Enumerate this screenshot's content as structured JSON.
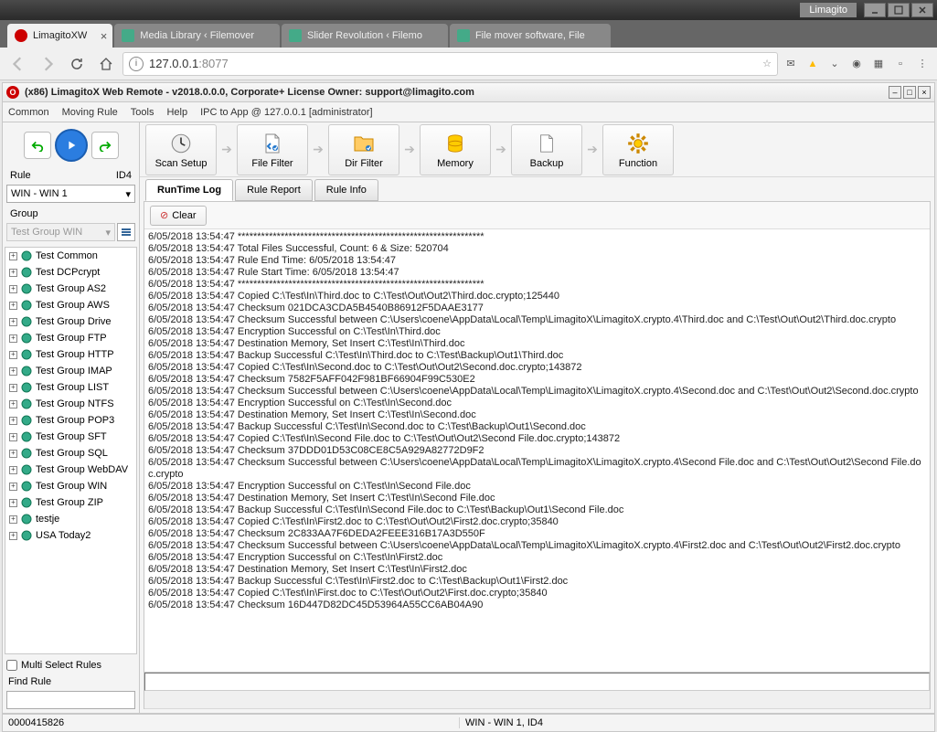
{
  "window": {
    "app_label": "Limagito"
  },
  "browser_tabs": [
    {
      "label": "LimagitoXW",
      "active": true
    },
    {
      "label": "Media Library ‹ Filemover",
      "active": false
    },
    {
      "label": "Slider Revolution ‹ Filemo",
      "active": false
    },
    {
      "label": "File mover software, File",
      "active": false
    }
  ],
  "url": {
    "host": "127.0.0.1",
    "port": ":8077"
  },
  "app_title": "(x86) LimagitoX Web Remote - v2018.0.0.0, Corporate+ License Owner: support@limagito.com",
  "menu": {
    "common": "Common",
    "moving_rule": "Moving Rule",
    "tools": "Tools",
    "help": "Help",
    "ipc": "IPC to App @ 127.0.0.1 [administrator]"
  },
  "left": {
    "rule_label": "Rule",
    "id_label": "ID4",
    "rule_value": "WIN - WIN 1",
    "group_label": "Group",
    "group_value": "Test Group WIN",
    "multi_select": "Multi Select Rules",
    "find_label": "Find Rule",
    "tree": [
      "Test Common",
      "Test DCPcrypt",
      "Test Group AS2",
      "Test Group AWS",
      "Test Group Drive",
      "Test Group FTP",
      "Test Group HTTP",
      "Test Group IMAP",
      "Test Group LIST",
      "Test Group NTFS",
      "Test Group POP3",
      "Test Group SFT",
      "Test Group SQL",
      "Test Group WebDAV",
      "Test Group WIN",
      "Test Group ZIP",
      "testje",
      "USA Today2"
    ]
  },
  "toolbar": {
    "scan_setup": "Scan Setup",
    "file_filter": "File Filter",
    "dir_filter": "Dir Filter",
    "memory": "Memory",
    "backup": "Backup",
    "function": "Function"
  },
  "tabs": {
    "runtime": "RunTime Log",
    "report": "Rule Report",
    "info": "Rule Info"
  },
  "clear_btn": "Clear",
  "log_lines": [
    "6/05/2018 13:54:47 ***************************************************************",
    "6/05/2018 13:54:47 Total Files Successful, Count: 6 & Size: 520704",
    "6/05/2018 13:54:47 Rule End Time: 6/05/2018 13:54:47",
    "6/05/2018 13:54:47 Rule Start Time: 6/05/2018 13:54:47",
    "6/05/2018 13:54:47 ***************************************************************",
    "6/05/2018 13:54:47 Copied C:\\Test\\In\\Third.doc to C:\\Test\\Out\\Out2\\Third.doc.crypto;125440",
    "6/05/2018 13:54:47 Checksum 021DCA3CDA5B4540B86912F5DAAE3177",
    "6/05/2018 13:54:47 Checksum Successful between C:\\Users\\coene\\AppData\\Local\\Temp\\LimagitoX\\LimagitoX.crypto.4\\Third.doc and C:\\Test\\Out\\Out2\\Third.doc.crypto",
    "6/05/2018 13:54:47 Encryption Successful on C:\\Test\\In\\Third.doc",
    "6/05/2018 13:54:47 Destination Memory, Set Insert C:\\Test\\In\\Third.doc",
    "6/05/2018 13:54:47 Backup Successful C:\\Test\\In\\Third.doc to C:\\Test\\Backup\\Out1\\Third.doc",
    "6/05/2018 13:54:47 Copied C:\\Test\\In\\Second.doc to C:\\Test\\Out\\Out2\\Second.doc.crypto;143872",
    "6/05/2018 13:54:47 Checksum 7582F5AFF042F981BF66904F99C530E2",
    "6/05/2018 13:54:47 Checksum Successful between C:\\Users\\coene\\AppData\\Local\\Temp\\LimagitoX\\LimagitoX.crypto.4\\Second.doc and C:\\Test\\Out\\Out2\\Second.doc.crypto",
    "6/05/2018 13:54:47 Encryption Successful on C:\\Test\\In\\Second.doc",
    "6/05/2018 13:54:47 Destination Memory, Set Insert C:\\Test\\In\\Second.doc",
    "6/05/2018 13:54:47 Backup Successful C:\\Test\\In\\Second.doc to C:\\Test\\Backup\\Out1\\Second.doc",
    "6/05/2018 13:54:47 Copied C:\\Test\\In\\Second File.doc to C:\\Test\\Out\\Out2\\Second File.doc.crypto;143872",
    "6/05/2018 13:54:47 Checksum 37DDD01D53C08CE8C5A929A82772D9F2",
    "6/05/2018 13:54:47 Checksum Successful between C:\\Users\\coene\\AppData\\Local\\Temp\\LimagitoX\\LimagitoX.crypto.4\\Second File.doc and C:\\Test\\Out\\Out2\\Second File.doc.crypto",
    "6/05/2018 13:54:47 Encryption Successful on C:\\Test\\In\\Second File.doc",
    "6/05/2018 13:54:47 Destination Memory, Set Insert C:\\Test\\In\\Second File.doc",
    "6/05/2018 13:54:47 Backup Successful C:\\Test\\In\\Second File.doc to C:\\Test\\Backup\\Out1\\Second File.doc",
    "6/05/2018 13:54:47 Copied C:\\Test\\In\\First2.doc to C:\\Test\\Out\\Out2\\First2.doc.crypto;35840",
    "6/05/2018 13:54:47 Checksum 2C833AA7F6DEDA2FEEE316B17A3D550F",
    "6/05/2018 13:54:47 Checksum Successful between C:\\Users\\coene\\AppData\\Local\\Temp\\LimagitoX\\LimagitoX.crypto.4\\First2.doc and C:\\Test\\Out\\Out2\\First2.doc.crypto",
    "6/05/2018 13:54:47 Encryption Successful on C:\\Test\\In\\First2.doc",
    "6/05/2018 13:54:47 Destination Memory, Set Insert C:\\Test\\In\\First2.doc",
    "6/05/2018 13:54:47 Backup Successful C:\\Test\\In\\First2.doc to C:\\Test\\Backup\\Out1\\First2.doc",
    "6/05/2018 13:54:47 Copied C:\\Test\\In\\First.doc to C:\\Test\\Out\\Out2\\First.doc.crypto;35840",
    "6/05/2018 13:54:47 Checksum 16D447D82DC45D53964A55CC6AB04A90"
  ],
  "status": {
    "left": "0000415826",
    "right": "WIN - WIN 1, ID4"
  }
}
